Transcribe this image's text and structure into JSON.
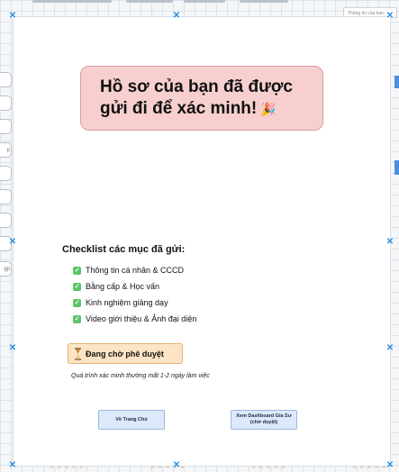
{
  "background": {
    "right_label": "Thông tin của bạn",
    "left_pill_letters": [
      "p",
      "gp"
    ],
    "stars": "★★★★★"
  },
  "banner": {
    "text": "Hồ sơ của bạn đã được gửi đi để xác minh!",
    "emoji": "🎉"
  },
  "checklist": {
    "title": "Checklist các mục đã gửi:",
    "items": [
      "Thông tin cá nhân & CCCD",
      "Bằng cấp & Học vấn",
      "Kinh nghiệm giảng dạy",
      "Video giới thiệu & Ảnh đại diện"
    ]
  },
  "status": {
    "label": "Đang chờ phê duyệt",
    "icon": "hourglass-icon"
  },
  "note": "Quá trình xác minh thường mất 1-2 ngày làm việc",
  "buttons": {
    "home": "Về Trang Chủ",
    "dashboard_line1": "Xem Dashboard Gia Sư",
    "dashboard_line2": "(chờ duyệt)"
  },
  "colors": {
    "banner_bg": "#f7cfcf",
    "status_bg": "#fde4c6",
    "check_green": "#5cc46a",
    "button_bg": "#dce9fb",
    "handle_blue": "#2a8fe0"
  }
}
